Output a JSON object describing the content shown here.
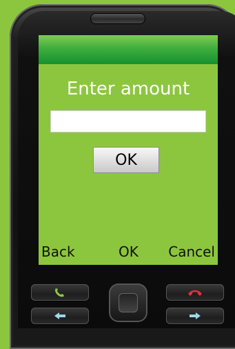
{
  "dialog": {
    "prompt": "Enter amount",
    "amount_value": "",
    "ok_label": "OK"
  },
  "softkeys": {
    "left": "Back",
    "center": "OK",
    "right": "Cancel"
  },
  "keypad": {
    "call_icon_color": "#8cc63f",
    "end_icon_color": "#e0323c",
    "nav_icon_color": "#9fd6e8"
  },
  "colors": {
    "background": "#8cc63f",
    "title_bar": "#2ea53a",
    "screen": "#8cc63f"
  }
}
